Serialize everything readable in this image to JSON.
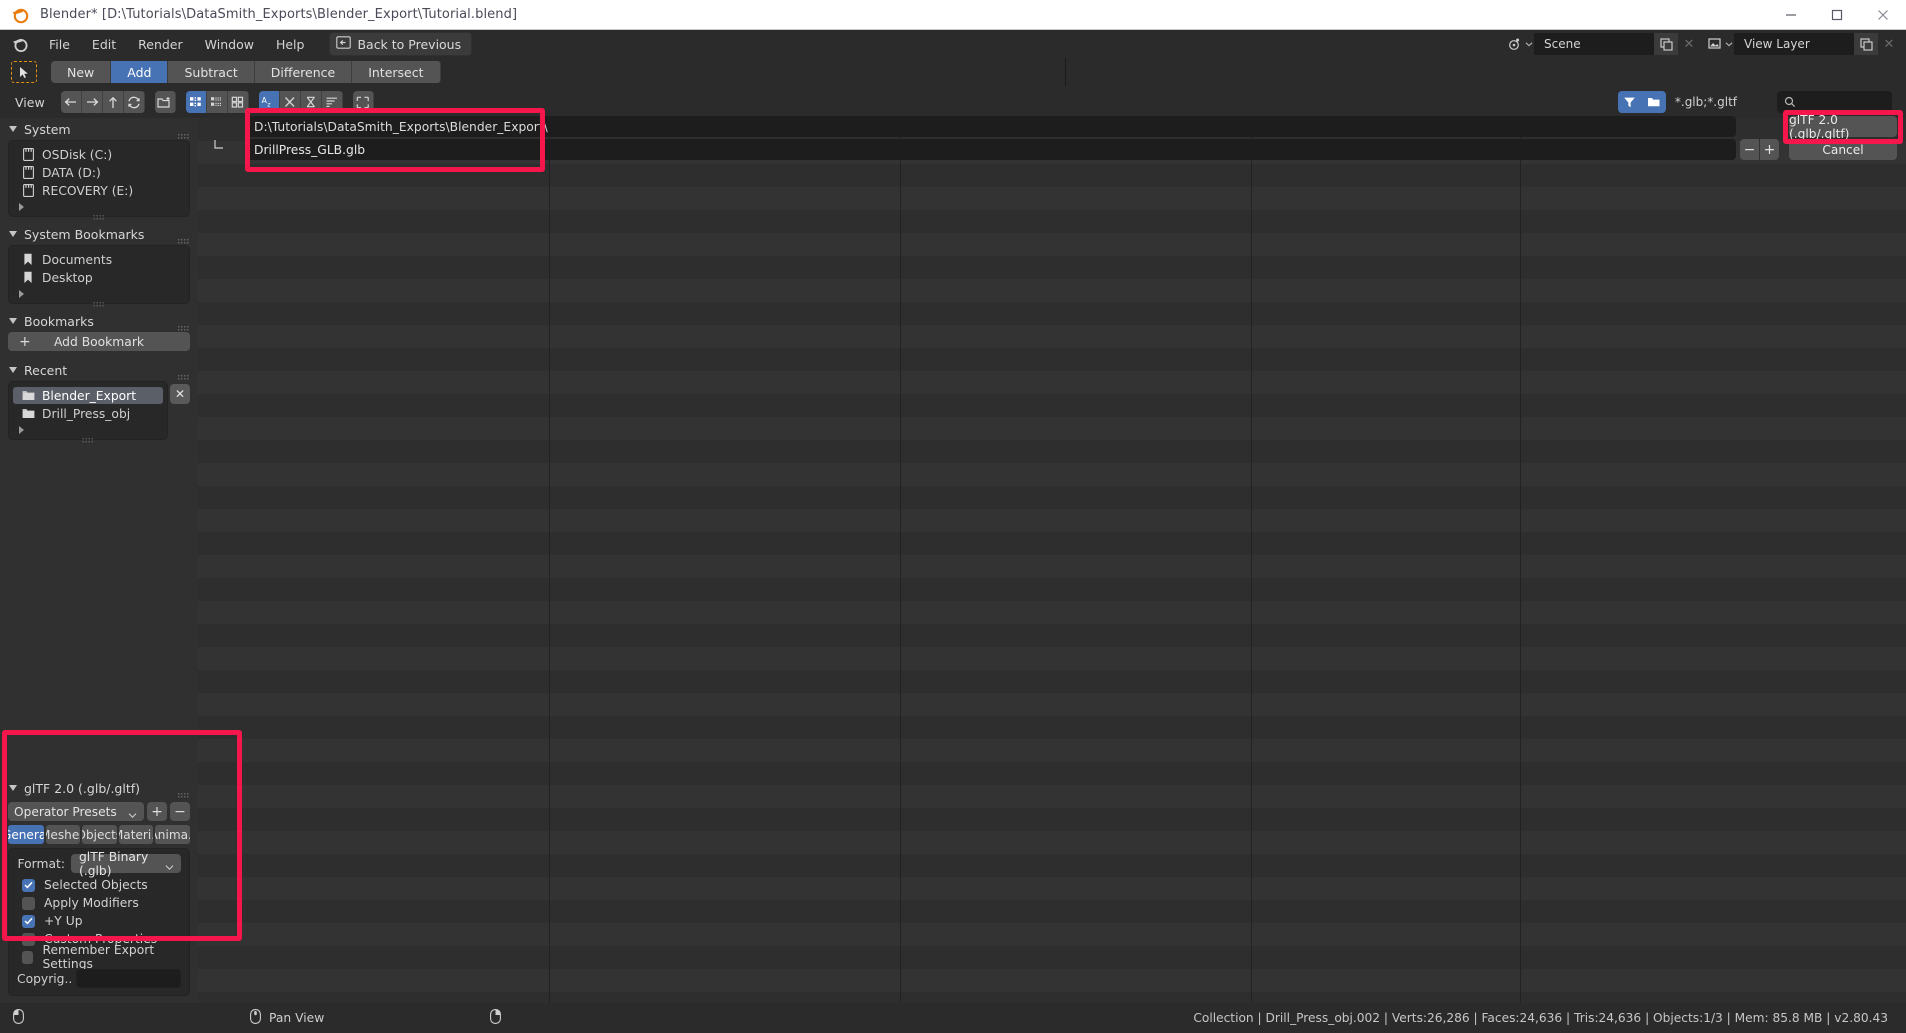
{
  "titlebar": {
    "title": "Blender* [D:\\Tutorials\\DataSmith_Exports\\Blender_Export\\Tutorial.blend]",
    "minimize": "minimize-icon",
    "maximize": "maximize-icon",
    "close": "close-icon"
  },
  "menubar": {
    "items": [
      "File",
      "Edit",
      "Render",
      "Window",
      "Help"
    ],
    "back_to_previous": "Back to Previous",
    "scene_value": "Scene",
    "view_layer_value": "View Layer"
  },
  "operator_toolbar": {
    "buttons": [
      "New",
      "Add",
      "Subtract",
      "Difference",
      "Intersect"
    ],
    "active": "Add"
  },
  "filebrowser_header": {
    "view_label": "View",
    "filter_pattern": "*.glb;*.gltf",
    "search_placeholder": ""
  },
  "sidebar": {
    "sections": [
      {
        "title": "System",
        "items": [
          {
            "label": "OSDisk (C:)",
            "icon": "drive-icon"
          },
          {
            "label": "DATA (D:)",
            "icon": "drive-icon"
          },
          {
            "label": "RECOVERY (E:)",
            "icon": "drive-icon"
          }
        ]
      },
      {
        "title": "System Bookmarks",
        "items": [
          {
            "label": "Documents",
            "icon": "bookmark-icon"
          },
          {
            "label": "Desktop",
            "icon": "bookmark-icon"
          }
        ]
      },
      {
        "title": "Bookmarks",
        "add_bookmark": "Add Bookmark"
      },
      {
        "title": "Recent",
        "items": [
          {
            "label": "Blender_Export",
            "icon": "folder-icon",
            "selected": true
          },
          {
            "label": "Drill_Press_obj",
            "icon": "folder-icon",
            "selected": false
          }
        ]
      }
    ]
  },
  "operator_panel": {
    "title": "glTF 2.0 (.glb/.gltf)",
    "preset_label": "Operator Presets",
    "preset_add": "+",
    "preset_remove": "−",
    "tabs": [
      "General",
      "Meshes",
      "Objects",
      "Materi..",
      "Anima.."
    ],
    "active_tab": "General",
    "format_label": "Format:",
    "format_value": "glTF Binary (.glb)",
    "checkboxes": [
      {
        "label": "Selected Objects",
        "checked": true
      },
      {
        "label": "Apply Modifiers",
        "checked": false
      },
      {
        "label": "+Y Up",
        "checked": true
      },
      {
        "label": "Custom Properties",
        "checked": false
      },
      {
        "label": "Remember Export Settings",
        "checked": false
      }
    ],
    "copyright_label": "Copyrig..",
    "copyright_value": ""
  },
  "path_bar": {
    "directory": "D:\\Tutorials\\DataSmith_Exports\\Blender_Export\\",
    "filename": "DrillPress_GLB.glb",
    "decrement": "−",
    "increment": "+",
    "export_button": "glTF 2.0 (.glb/.gltf)",
    "cancel_button": "Cancel"
  },
  "statusbar": {
    "pan_view": "Pan View",
    "stats": "Collection | Drill_Press_obj.002 | Verts:26,286 | Faces:24,636 | Tris:24,636 | Objects:1/3 | Mem: 85.8 MB | v2.80.43"
  },
  "colors": {
    "accent_blue": "#4772b3",
    "highlight_red": "#f5174b",
    "panel_bg": "#303030",
    "field_bg": "#1d1d1d"
  }
}
